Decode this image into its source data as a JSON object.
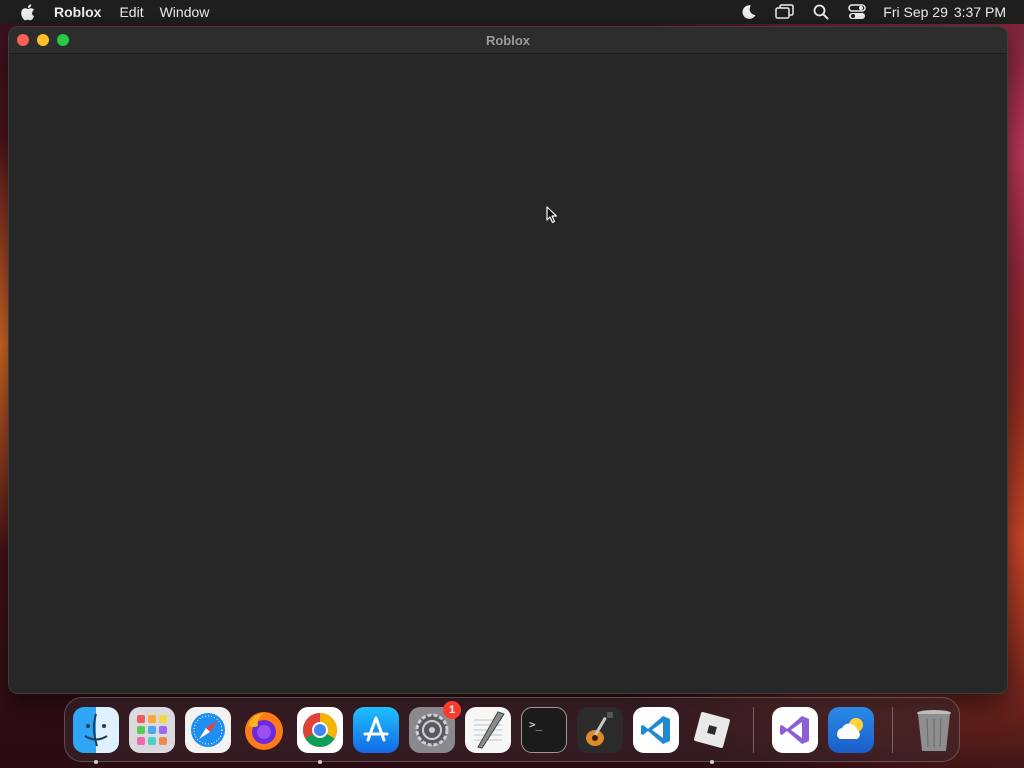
{
  "menubar": {
    "app_name": "Roblox",
    "menus": [
      "Edit",
      "Window"
    ],
    "clock": {
      "date": "Fri Sep 29",
      "time": "3:37 PM"
    },
    "status_icons": [
      "moon-icon",
      "screen-mirroring-icon",
      "search-icon",
      "control-center-icon"
    ]
  },
  "window": {
    "title": "Roblox"
  },
  "dock": {
    "apps": [
      {
        "name": "Finder",
        "icon": "finder-icon",
        "running": true
      },
      {
        "name": "Launchpad",
        "icon": "launchpad-icon",
        "running": false
      },
      {
        "name": "Safari",
        "icon": "safari-icon",
        "running": false
      },
      {
        "name": "Firefox",
        "icon": "firefox-icon",
        "running": false
      },
      {
        "name": "Google Chrome",
        "icon": "chrome-icon",
        "running": true
      },
      {
        "name": "App Store",
        "icon": "app-store-icon",
        "running": false
      },
      {
        "name": "System Settings",
        "icon": "system-settings-icon",
        "running": false,
        "badge": "1"
      },
      {
        "name": "TextEdit",
        "icon": "textedit-icon",
        "running": false
      },
      {
        "name": "Terminal",
        "icon": "terminal-icon",
        "running": false
      },
      {
        "name": "GarageBand",
        "icon": "garageband-icon",
        "running": false
      },
      {
        "name": "Visual Studio Code",
        "icon": "vscode-icon",
        "running": false
      },
      {
        "name": "Roblox",
        "icon": "roblox-icon",
        "running": true
      }
    ],
    "recent": [
      {
        "name": "Visual Studio",
        "icon": "visual-studio-icon"
      },
      {
        "name": "Weather",
        "icon": "weather-icon"
      }
    ],
    "trash": {
      "name": "Trash",
      "icon": "trash-icon"
    }
  }
}
